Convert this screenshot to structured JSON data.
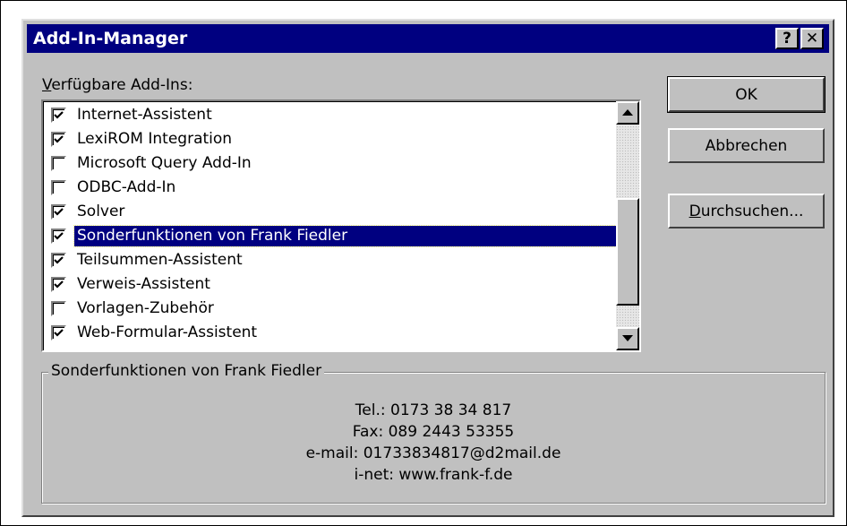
{
  "dialog": {
    "title": "Add-In-Manager",
    "help_label": "?",
    "close_label": "✕"
  },
  "list": {
    "label_access": "V",
    "label_rest": "erfügbare Add-Ins:",
    "items": [
      {
        "label": "Internet-Assistent",
        "checked": true
      },
      {
        "label": "LexiROM Integration",
        "checked": true
      },
      {
        "label": "Microsoft Query Add-In",
        "checked": false
      },
      {
        "label": "ODBC-Add-In",
        "checked": false
      },
      {
        "label": "Solver",
        "checked": true
      },
      {
        "label": "Sonderfunktionen von Frank Fiedler",
        "checked": true,
        "selected": true
      },
      {
        "label": "Teilsummen-Assistent",
        "checked": true
      },
      {
        "label": "Verweis-Assistent",
        "checked": true
      },
      {
        "label": "Vorlagen-Zubehör",
        "checked": false
      },
      {
        "label": "Web-Formular-Assistent",
        "checked": true
      }
    ]
  },
  "buttons": {
    "ok": "OK",
    "cancel": "Abbrechen",
    "browse_access": "D",
    "browse_rest": "urchsuchen..."
  },
  "details": {
    "title": "Sonderfunktionen von Frank Fiedler",
    "lines": [
      "Tel.: 0173 38 34 817",
      "Fax: 089 2443 53355",
      "e-mail: 01733834817@d2mail.de",
      "i-net: www.frank-f.de"
    ]
  },
  "icons": {
    "scroll_up": "up-arrow-icon",
    "scroll_down": "down-arrow-icon",
    "checkbox_check": "checkmark-icon"
  }
}
